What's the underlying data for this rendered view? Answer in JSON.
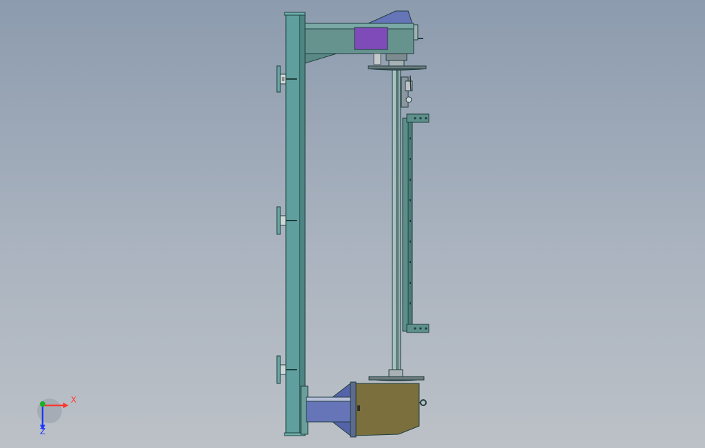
{
  "triad": {
    "x_label": "X",
    "z_label": "Z"
  },
  "colors": {
    "frame": "#5f9f9d",
    "beam": "#67938f",
    "purple_plate": "#7f4bb8",
    "bracket": "#6674b8",
    "motor_box": "#7b6f3d",
    "axis_x": "#ff3b30",
    "axis_y": "#18b12b",
    "axis_z": "#1f39ff"
  }
}
